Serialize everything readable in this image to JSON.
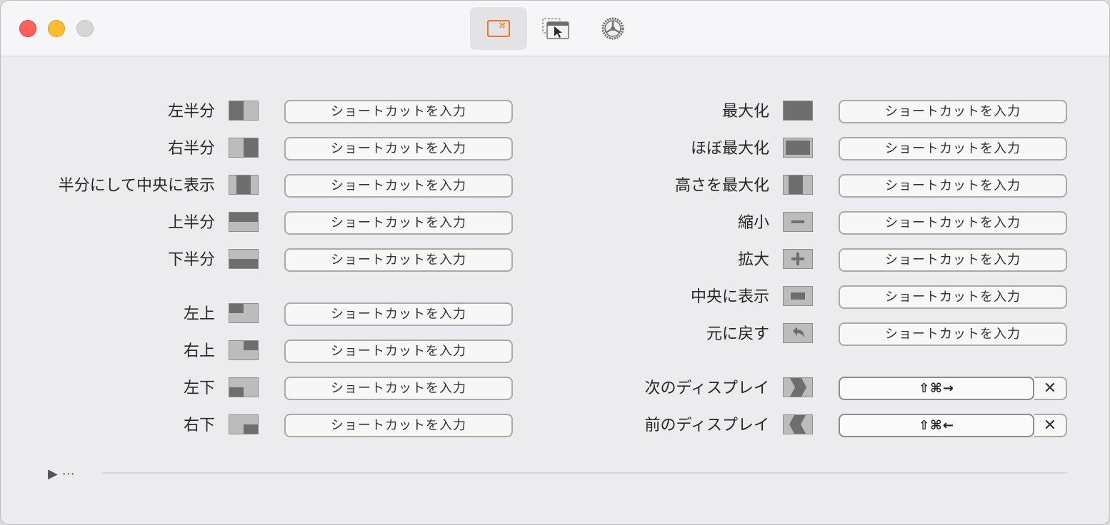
{
  "toolbar": {
    "tabs": [
      {
        "icon": "keyboard-shortcuts-icon",
        "active": true
      },
      {
        "icon": "snap-area-icon",
        "active": false
      },
      {
        "icon": "general-settings-icon",
        "active": false
      }
    ]
  },
  "placeholder": "ショートカットを入力",
  "left_actions": [
    {
      "label": "左半分",
      "icon": "left-half-icon"
    },
    {
      "label": "右半分",
      "icon": "right-half-icon"
    },
    {
      "label": "半分にして中央に表示",
      "icon": "center-half-icon"
    },
    {
      "label": "上半分",
      "icon": "top-half-icon"
    },
    {
      "label": "下半分",
      "icon": "bottom-half-icon"
    },
    {
      "label": "左上",
      "icon": "top-left-icon"
    },
    {
      "label": "右上",
      "icon": "top-right-icon"
    },
    {
      "label": "左下",
      "icon": "bottom-left-icon"
    },
    {
      "label": "右下",
      "icon": "bottom-right-icon"
    }
  ],
  "right_actions": [
    {
      "label": "最大化",
      "icon": "maximize-icon"
    },
    {
      "label": "ほぼ最大化",
      "icon": "almost-maximize-icon"
    },
    {
      "label": "高さを最大化",
      "icon": "maximize-height-icon"
    },
    {
      "label": "縮小",
      "icon": "minus-icon"
    },
    {
      "label": "拡大",
      "icon": "plus-icon"
    },
    {
      "label": "中央に表示",
      "icon": "center-icon"
    },
    {
      "label": "元に戻す",
      "icon": "restore-icon"
    }
  ],
  "display_actions": [
    {
      "label": "次のディスプレイ",
      "icon": "next-display-icon",
      "shortcut": "⇧⌘→"
    },
    {
      "label": "前のディスプレイ",
      "icon": "previous-display-icon",
      "shortcut": "⇧⌘←"
    }
  ],
  "clear_symbol": "✕",
  "more": {
    "arrow": "▶",
    "dots": "⋯"
  },
  "colors": {
    "accent": "#e8782a",
    "icon_dark": "#6e6e6e",
    "icon_light": "#bcbcbc"
  }
}
